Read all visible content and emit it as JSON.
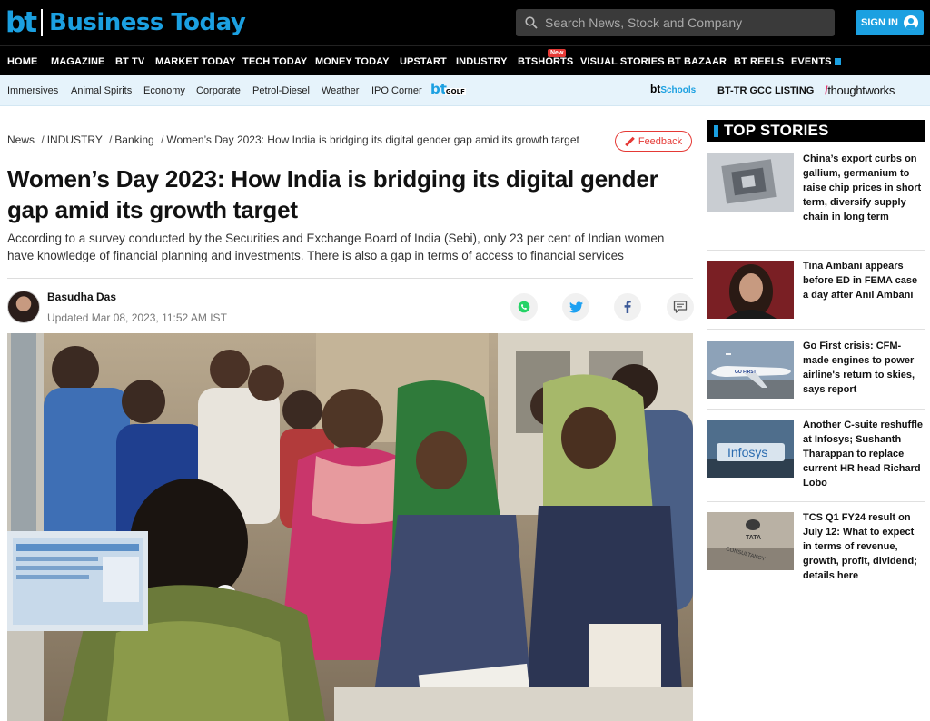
{
  "header": {
    "logo_short": "bt",
    "logo_name": "Business Today",
    "search_placeholder": "Search News, Stock and Company",
    "signin_label": "SIGN IN"
  },
  "main_nav": {
    "items": [
      "HOME",
      "MAGAZINE",
      "BT TV",
      "MARKET TODAY",
      "TECH TODAY",
      "MONEY TODAY",
      "UPSTART",
      "INDUSTRY",
      "BTSHORTS",
      "VISUAL STORIES",
      "BT BAZAAR",
      "BT REELS",
      "EVENTS"
    ],
    "new_badge": "New"
  },
  "sub_nav": {
    "items": [
      "Immersives",
      "Animal Spirits",
      "Economy",
      "Corporate",
      "Petrol-Diesel",
      "Weather",
      "IPO Corner"
    ],
    "golf_logo": "bt",
    "golf_label": "GOLF",
    "schools_logo": "bt",
    "schools_label": "Schools",
    "gcc_listing": "BT-TR GCC LISTING",
    "thoughtworks_slash": "/",
    "thoughtworks_label": "thoughtworks"
  },
  "breadcrumb": {
    "items": [
      "News",
      "INDUSTRY",
      "Banking",
      "Women’s Day 2023: How India is bridging its digital gender gap amid its growth target"
    ],
    "separator": "/"
  },
  "feedback_label": "Feedback",
  "article": {
    "headline": "Women’s Day 2023: How India is bridging its digital gender gap amid its growth target",
    "summary": "According to a survey conducted by the Securities and Exchange Board of India (Sebi), only 23 per cent of Indian women have knowledge of financial planning and investments. There is also a gap in terms of access to financial services",
    "author": "Basudha Das",
    "updated": "Updated Mar 08, 2023, 11:52 AM IST"
  },
  "share_icons": [
    "whatsapp-icon",
    "twitter-icon",
    "facebook-icon",
    "comment-icon"
  ],
  "top_stories": {
    "heading": "TOP STORIES",
    "items": [
      {
        "title": "China’s export curbs on gallium, germanium to raise chip prices in short term, diversify supply chain in long term"
      },
      {
        "title": "Tina Ambani appears before ED in FEMA case a day after Anil Ambani"
      },
      {
        "title": "Go First crisis: CFM-made engines to power airline's return to skies, says report"
      },
      {
        "title": "Another C-suite reshuffle at Infosys; Sushanth Tharappan to replace current HR head Richard Lobo"
      },
      {
        "title": "TCS Q1 FY24 result on July 12: What to expect in terms of revenue, growth, profit, dividend; details here"
      }
    ],
    "thumb_texts": {
      "airline": "GO FIRST",
      "infosys": "Infosys",
      "tata": "TATA",
      "tata_sub": "CONSULTANCY"
    }
  },
  "colors": {
    "brand_blue": "#1ba0e1",
    "header_bg": "#000000",
    "subnav_bg": "#e6f3fb",
    "feedback_red": "#e53935"
  }
}
